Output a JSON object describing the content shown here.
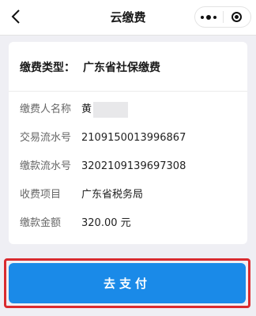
{
  "header": {
    "title": "云缴费",
    "back_icon": "chevron-left-icon",
    "more_icon": "more-dots-icon",
    "close_icon": "target-circle-icon"
  },
  "card": {
    "type_label": "缴费类型：",
    "type_value": "广东省社保缴费",
    "rows": [
      {
        "label": "缴费人名称",
        "value": "黄"
      },
      {
        "label": "交易流水号",
        "value": "2109150013996867"
      },
      {
        "label": "缴款流水号",
        "value": "3202109139697308"
      },
      {
        "label": "收费项目",
        "value": "广东省税务局"
      },
      {
        "label": "缴款金额",
        "value": "320.00 元"
      }
    ]
  },
  "pay_button": {
    "label": "去支付",
    "color": "#1a8ae8",
    "highlight_color": "#d92b2f"
  }
}
